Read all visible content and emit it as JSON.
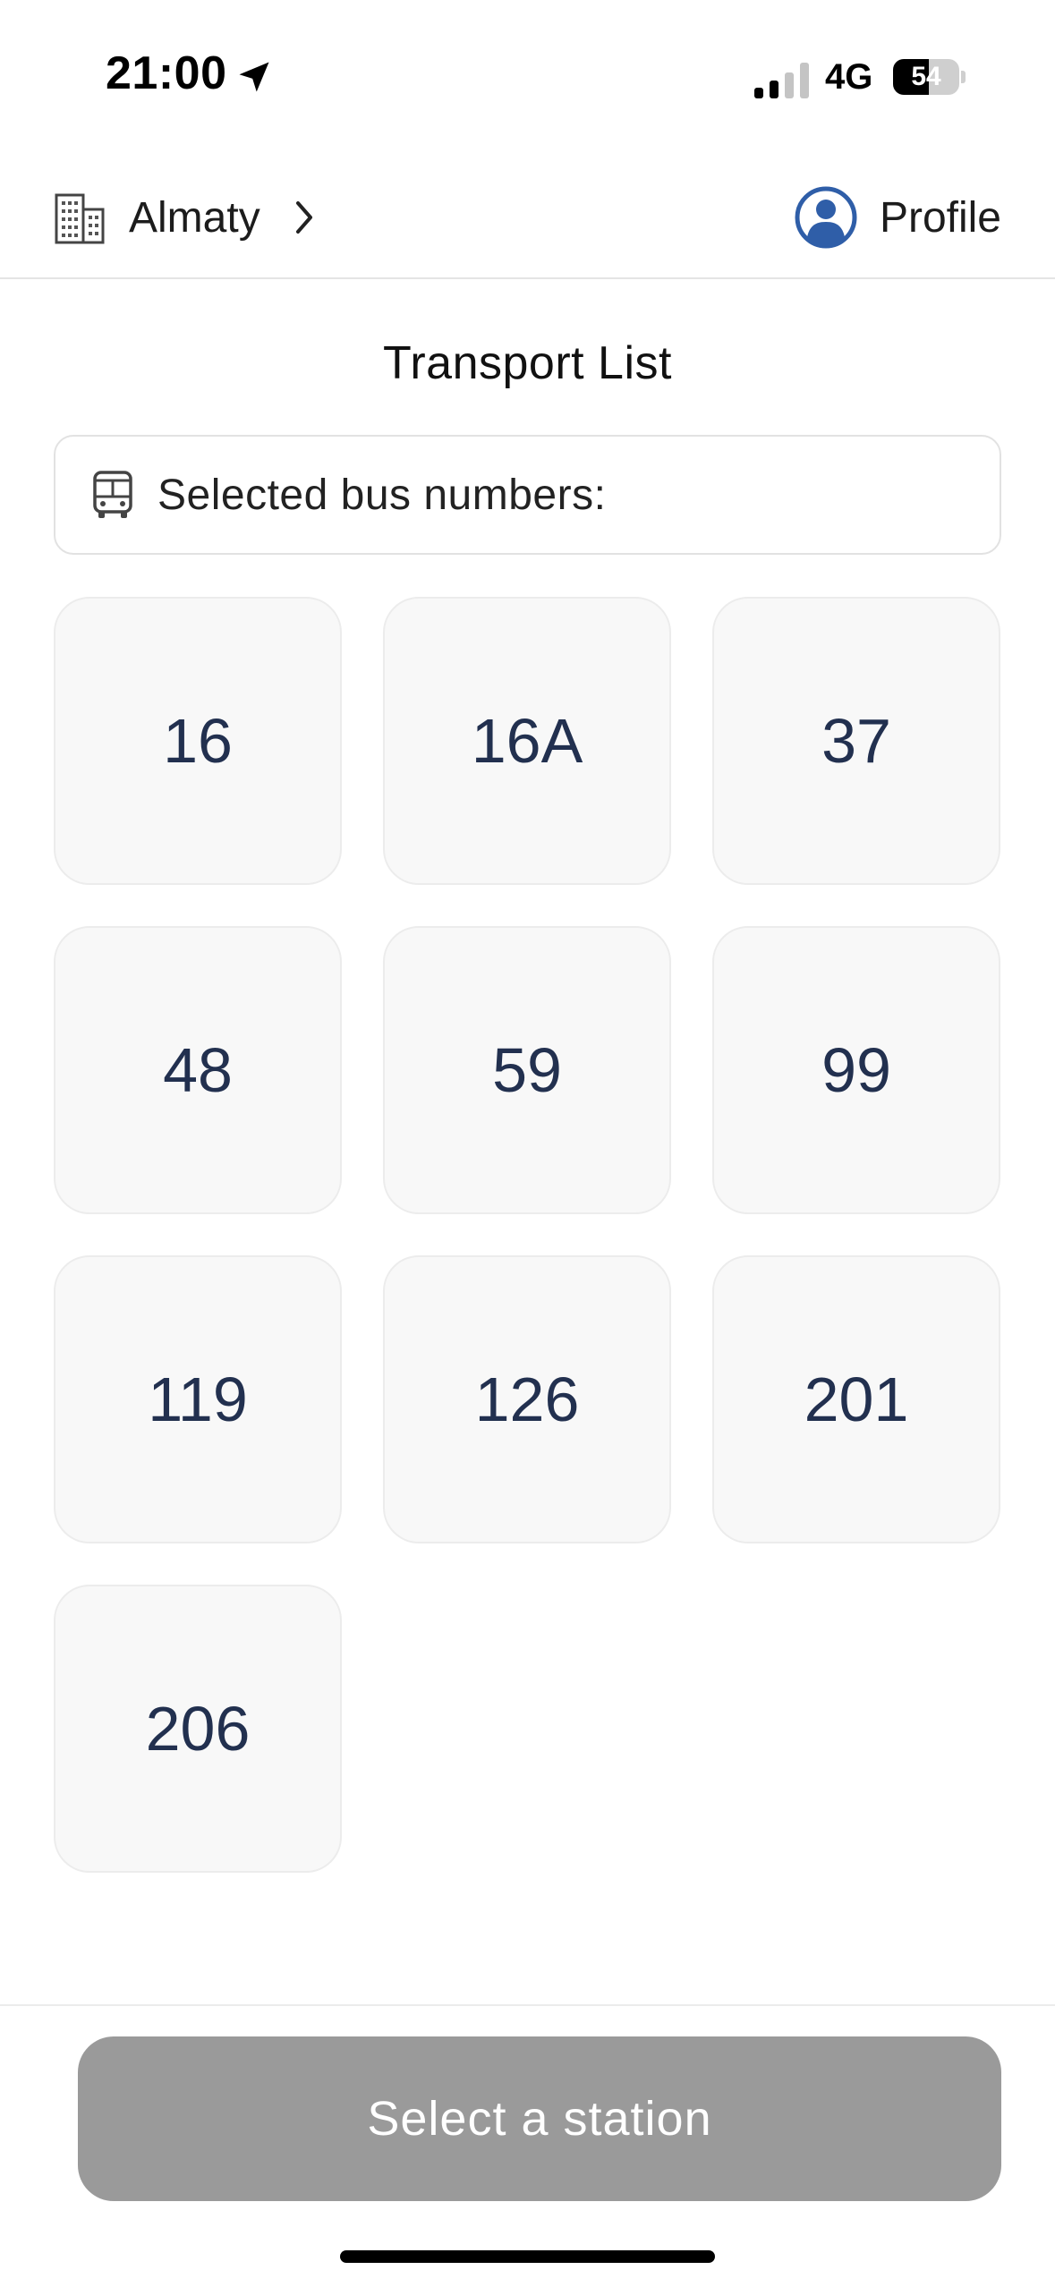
{
  "status_bar": {
    "time": "21:00",
    "network": "4G",
    "battery": "54",
    "battery_level": 0.54,
    "signal_bars_active": 2,
    "signal_bars_total": 4
  },
  "header": {
    "city": "Almaty",
    "profile_label": "Profile",
    "icons": {
      "city": "building-icon",
      "chevron": "chevron-right-icon",
      "profile": "user-circle-icon"
    }
  },
  "page": {
    "title": "Transport List",
    "selected_label": "Selected bus numbers:",
    "selected_icon": "bus-icon"
  },
  "buses": [
    "16",
    "16A",
    "37",
    "48",
    "59",
    "99",
    "119",
    "126",
    "201",
    "206"
  ],
  "footer": {
    "button_label": "Select a station"
  },
  "colors": {
    "accent_blue": "#2f5ea8",
    "tile_text": "#22304f",
    "tile_bg": "#f8f8f8",
    "button_disabled": "#9a9a9a"
  }
}
